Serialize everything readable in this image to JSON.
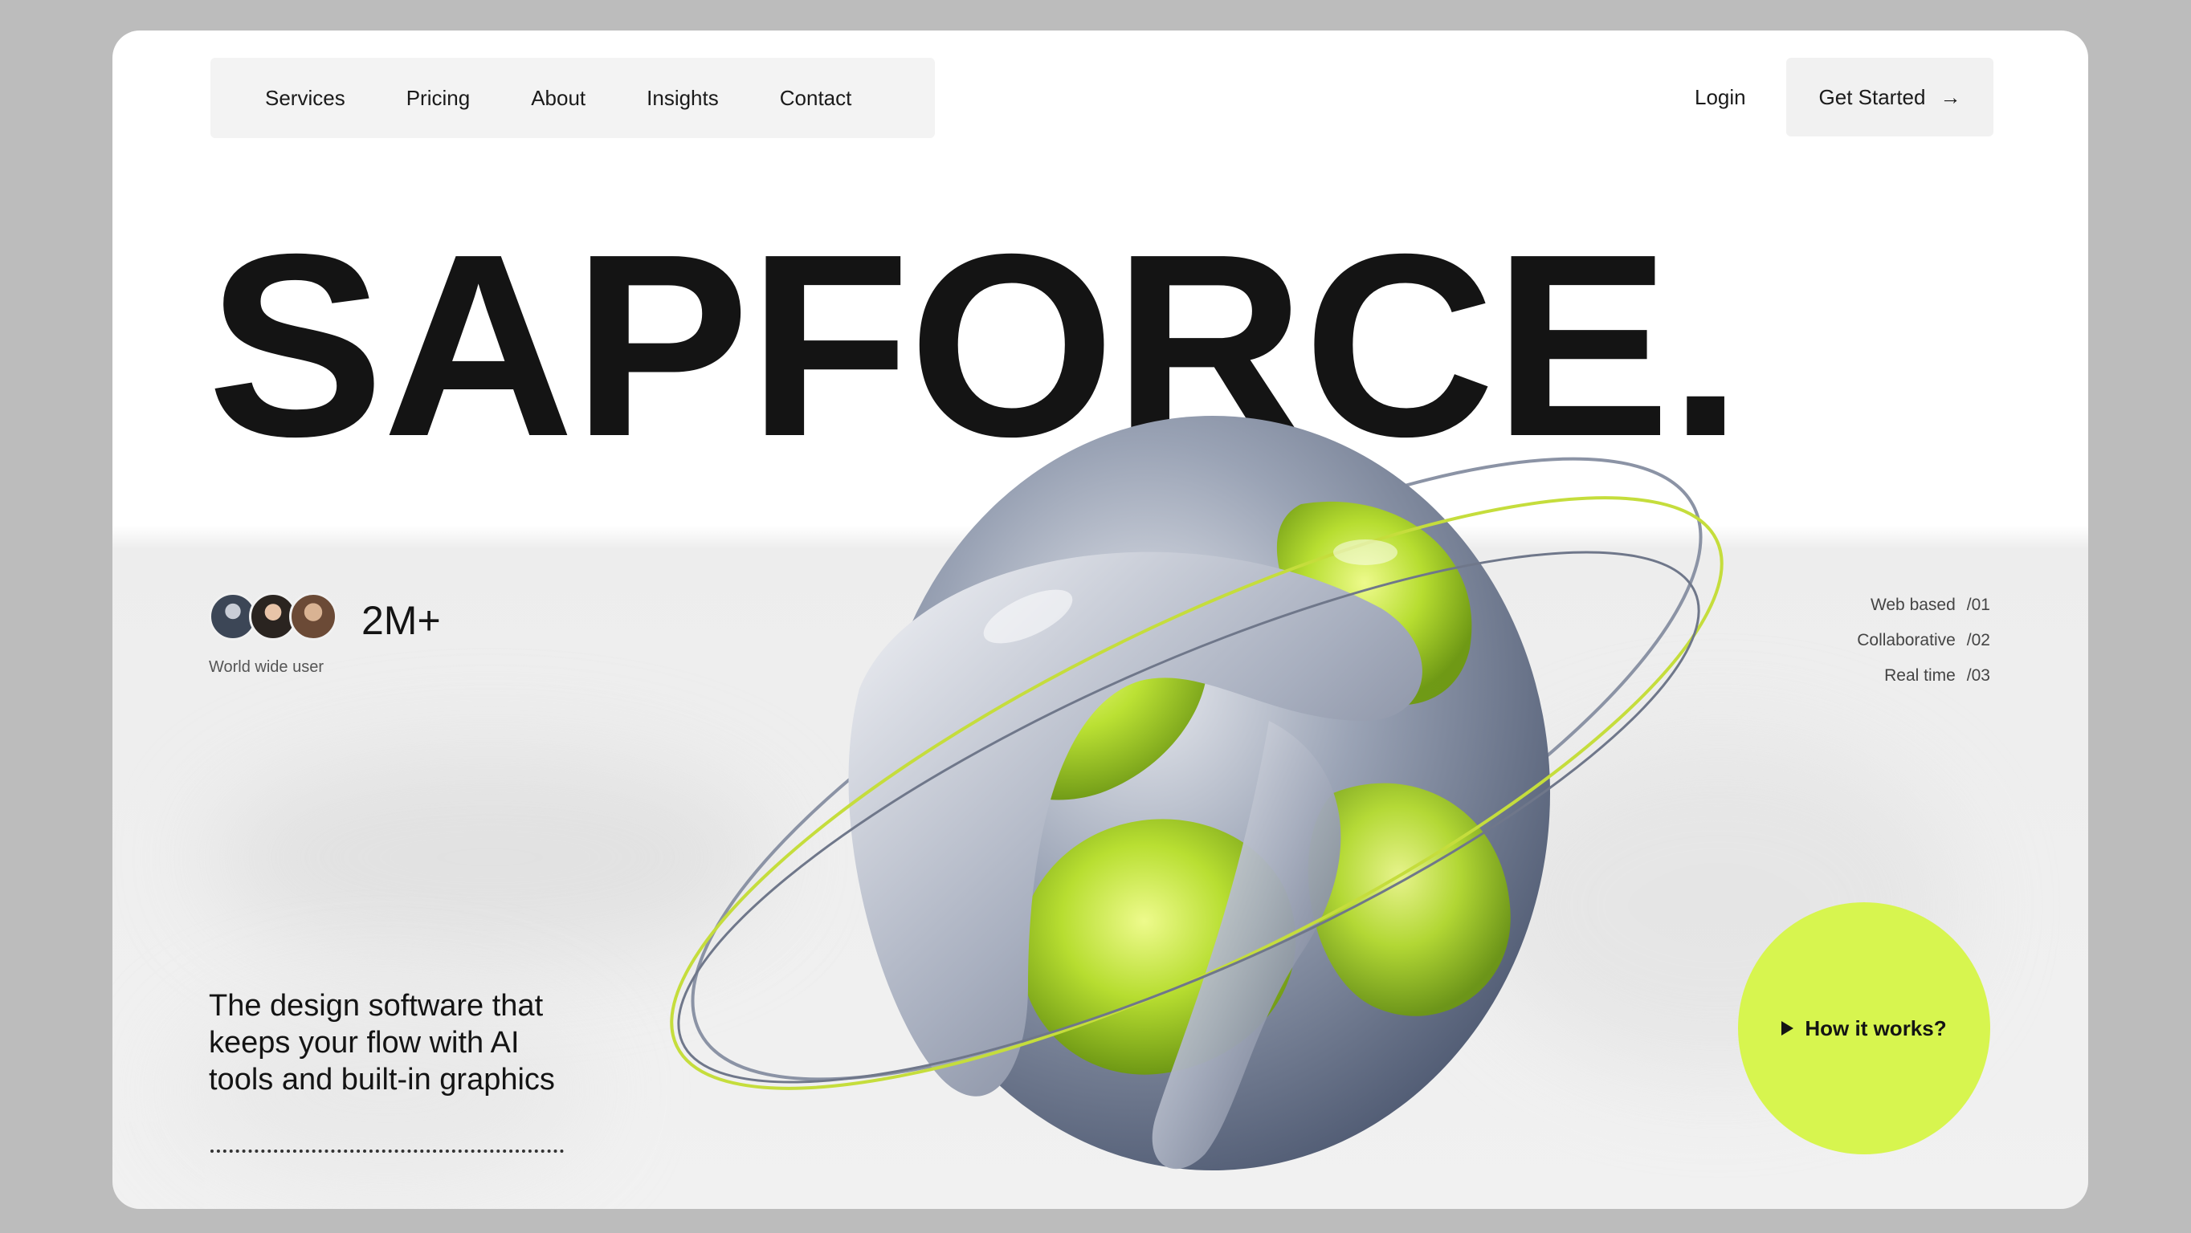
{
  "nav": {
    "links": [
      "Services",
      "Pricing",
      "About",
      "Insights",
      "Contact"
    ],
    "login_label": "Login",
    "get_started_label": "Get Started",
    "arrow_icon": "arrow-right-icon"
  },
  "hero": {
    "title": "SAPFORCE."
  },
  "social_proof": {
    "count": "2M+",
    "caption": "World wide user"
  },
  "features": [
    {
      "label": "Web based",
      "num": "/01"
    },
    {
      "label": "Collaborative",
      "num": "/02"
    },
    {
      "label": "Real time",
      "num": "/03"
    }
  ],
  "tagline": "The design software that keeps your flow with AI tools and built-in graphics",
  "cta": {
    "label": "How it works?",
    "icon": "play-icon",
    "color": "#d7f54f"
  },
  "colors": {
    "accent": "#d7f54f",
    "text": "#141414",
    "backdrop": "#bcbcbc"
  }
}
